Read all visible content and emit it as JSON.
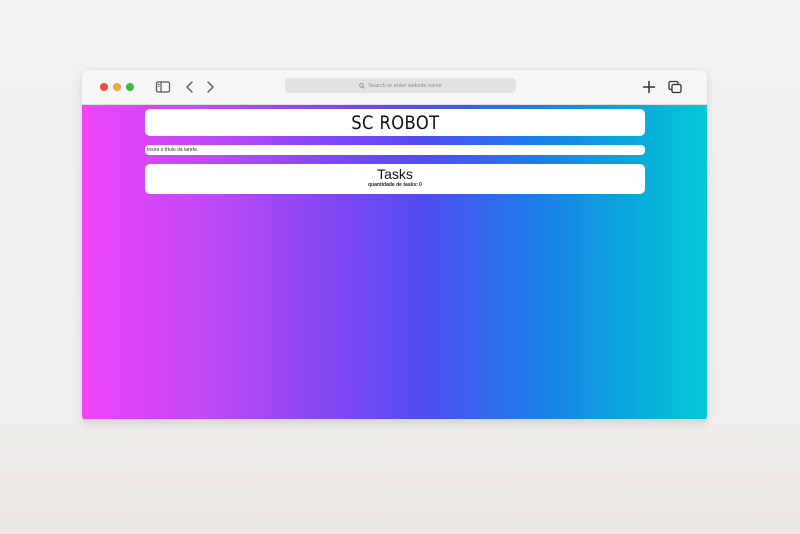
{
  "browser": {
    "address_placeholder": "Search or enter website name",
    "icons": {
      "sidebar": "sidebar-toggle-icon",
      "back": "chevron-left-icon",
      "forward": "chevron-right-icon",
      "search": "search-icon",
      "new_tab": "plus-icon",
      "tabs": "tab-overview-icon"
    },
    "traffic_light_colors": [
      "#ee4b43",
      "#f2a43a",
      "#3fb843"
    ]
  },
  "app": {
    "title": "SC ROBOT",
    "task_input_placeholder": "Insira o título da tarefa",
    "tasks_heading": "Tasks",
    "tasks_count_text": "quantidade de tasks: 0",
    "background_gradient": [
      "#ee43fb",
      "#7a48f3",
      "#4f4df0",
      "#1e7cea",
      "#04c9d6"
    ]
  }
}
